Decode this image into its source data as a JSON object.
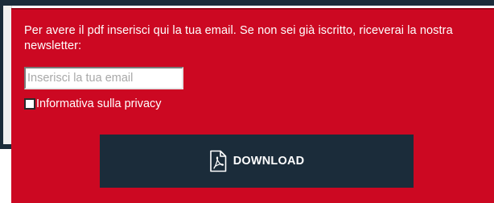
{
  "message": "Per avere il pdf inserisci qui la tua email. Se non sei già iscritto, riceverai la nostra newsletter:",
  "email_field": {
    "placeholder": "Inserisci la tua email",
    "value": ""
  },
  "privacy": {
    "label": "Informativa sulla privacy",
    "checked": false
  },
  "download_button": {
    "label": "DOWNLOAD",
    "icon": "pdf-file-icon"
  },
  "colors": {
    "panel_red": "#cc0822",
    "dark_navy": "#1b2c3a",
    "text_white": "#ffffff"
  }
}
